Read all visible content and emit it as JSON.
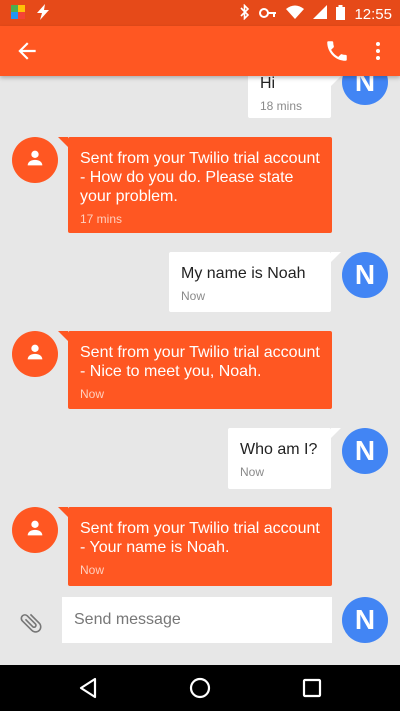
{
  "status_bar": {
    "time": "12:55",
    "left_icons": [
      "photos-icon",
      "flash-icon"
    ],
    "right_icons": [
      "bluetooth-icon",
      "key-icon",
      "wifi-icon",
      "cellular-signal-icon",
      "battery-icon"
    ]
  },
  "toolbar": {
    "title": "",
    "actions": [
      "back-arrow-icon",
      "phone-icon",
      "more-vert-icon"
    ]
  },
  "contact_avatar_letter": "N",
  "messages": [
    {
      "direction": "outgoing",
      "text": "Hi",
      "time": "18 mins"
    },
    {
      "direction": "incoming",
      "text": "Sent from your Twilio trial account - How do you do. Please state your problem.",
      "time": "17 mins"
    },
    {
      "direction": "outgoing",
      "text": "My name is Noah",
      "time": "Now"
    },
    {
      "direction": "incoming",
      "text": "Sent from your Twilio trial account - Nice to meet you, Noah.",
      "time": "Now"
    },
    {
      "direction": "outgoing",
      "text": "Who am I?",
      "time": "Now"
    },
    {
      "direction": "incoming",
      "text": "Sent from your Twilio trial account - Your name is Noah.",
      "time": "Now"
    }
  ],
  "composer": {
    "placeholder": "Send message",
    "value": ""
  },
  "nav_bar": {
    "buttons": [
      "back-triangle-icon",
      "home-circle-icon",
      "recents-square-icon"
    ]
  },
  "colors": {
    "status_bar": "#e64a19",
    "toolbar": "#ff5722",
    "incoming_bubble": "#ff5722",
    "outgoing_bubble": "#ffffff",
    "own_avatar": "#4285f4",
    "background": "#e7e7e7"
  }
}
